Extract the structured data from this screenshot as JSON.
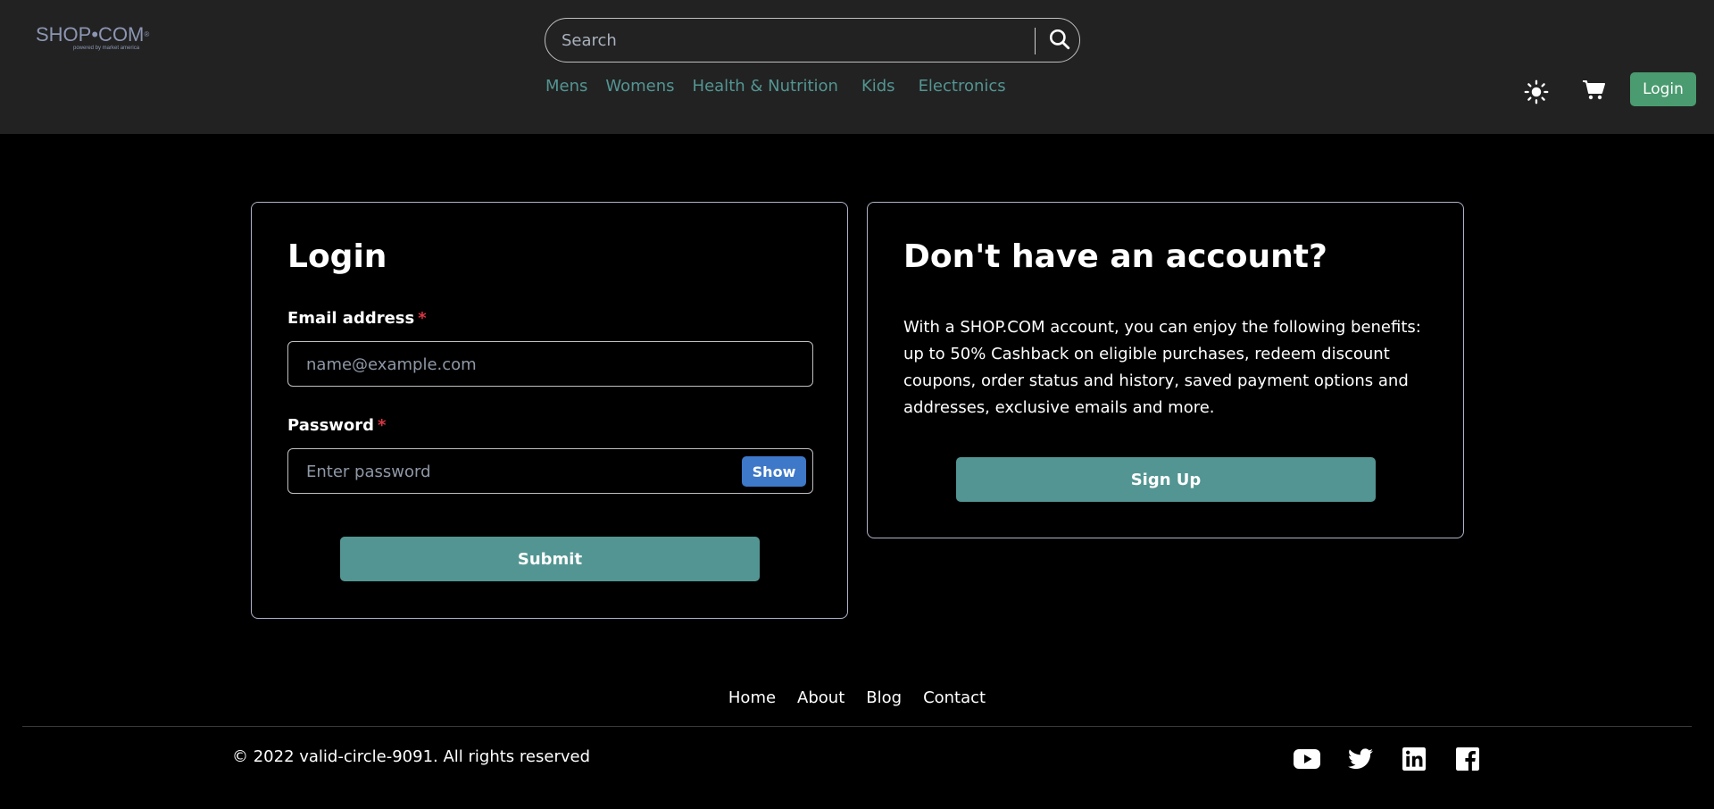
{
  "header": {
    "logo": {
      "text": "SHOP•COM",
      "mark": "®",
      "tagline": "powered by market america"
    },
    "search": {
      "placeholder": "Search",
      "value": "",
      "icon": "search-icon"
    },
    "nav": [
      "Mens",
      "Womens",
      "Health & Nutrition",
      "Kids",
      "Electronics"
    ],
    "theme_icon": "sun-icon",
    "cart_icon": "cart-icon",
    "login_label": "Login"
  },
  "login_card": {
    "title": "Login",
    "email": {
      "label": "Email address",
      "required": "*",
      "placeholder": "name@example.com",
      "value": ""
    },
    "password": {
      "label": "Password",
      "required": "*",
      "placeholder": "Enter password",
      "value": "",
      "show_label": "Show"
    },
    "submit_label": "Submit"
  },
  "signup_card": {
    "title": "Don't have an account?",
    "text": "With a SHOP.COM account, you can enjoy the following benefits: up to 50% Cashback on eligible purchases, redeem discount coupons, order status and history, saved payment options and addresses, exclusive emails and more.",
    "button_label": "Sign Up"
  },
  "footer": {
    "links": [
      "Home",
      "About",
      "Blog",
      "Contact"
    ],
    "copyright": "© 2022 valid-circle-9091. All rights reserved",
    "social": [
      "youtube-icon",
      "twitter-icon",
      "linkedin-icon",
      "facebook-icon"
    ]
  },
  "colors": {
    "header_bg": "#222222",
    "page_bg": "#000000",
    "nav_link": "#539592",
    "primary_button": "#539592",
    "login_button": "#4a9b6f",
    "show_button": "#3e78c8",
    "required": "#dc3545"
  }
}
